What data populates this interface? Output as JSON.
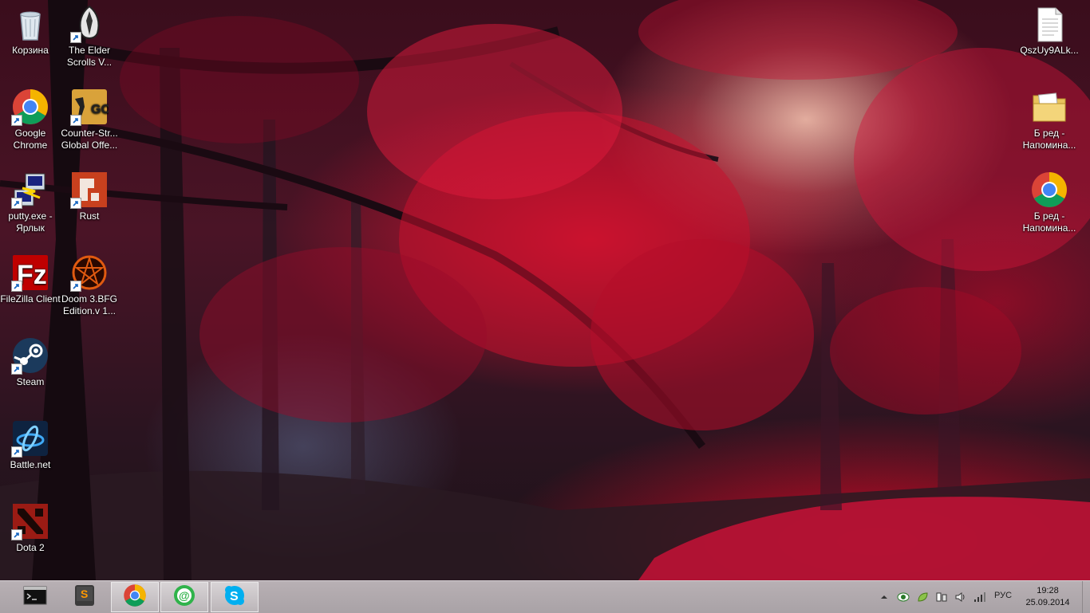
{
  "desktop": {
    "icons": [
      {
        "id": "recycle-bin",
        "label": "Корзина"
      },
      {
        "id": "elder-scrolls",
        "label": "The Elder Scrolls V..."
      },
      {
        "id": "google-chrome",
        "label": "Google Chrome"
      },
      {
        "id": "counter-strike",
        "label": "Counter-Str... Global Offe..."
      },
      {
        "id": "putty",
        "label": "putty.exe - Ярлык"
      },
      {
        "id": "rust",
        "label": "Rust"
      },
      {
        "id": "filezilla",
        "label": "FileZilla Client"
      },
      {
        "id": "doom3",
        "label": "Doom 3.BFG Edition.v 1..."
      },
      {
        "id": "steam",
        "label": "Steam"
      },
      {
        "id": "battlenet",
        "label": "Battle.net"
      },
      {
        "id": "dota2",
        "label": "Dota 2"
      },
      {
        "id": "text-file",
        "label": "QszUy9ALk..."
      },
      {
        "id": "folder",
        "label": "Б ред - Напомина..."
      },
      {
        "id": "chrome-reminder",
        "label": "Б ред - Напомина..."
      }
    ]
  },
  "taskbar": {
    "pinned": [
      {
        "name": "command-prompt",
        "icon": "console-icon"
      },
      {
        "name": "sublime-text",
        "icon": "sublime-icon"
      },
      {
        "name": "chrome",
        "icon": "chrome-icon"
      },
      {
        "name": "mail-agent",
        "icon": "mail-agent-icon"
      },
      {
        "name": "skype",
        "icon": "skype-icon"
      }
    ],
    "tray": {
      "language": "РУС",
      "time": "19:28",
      "date": "25.09.2014"
    }
  },
  "colors": {
    "taskbar_bg": "#b0a9ad",
    "accent_red": "#e0203c"
  }
}
